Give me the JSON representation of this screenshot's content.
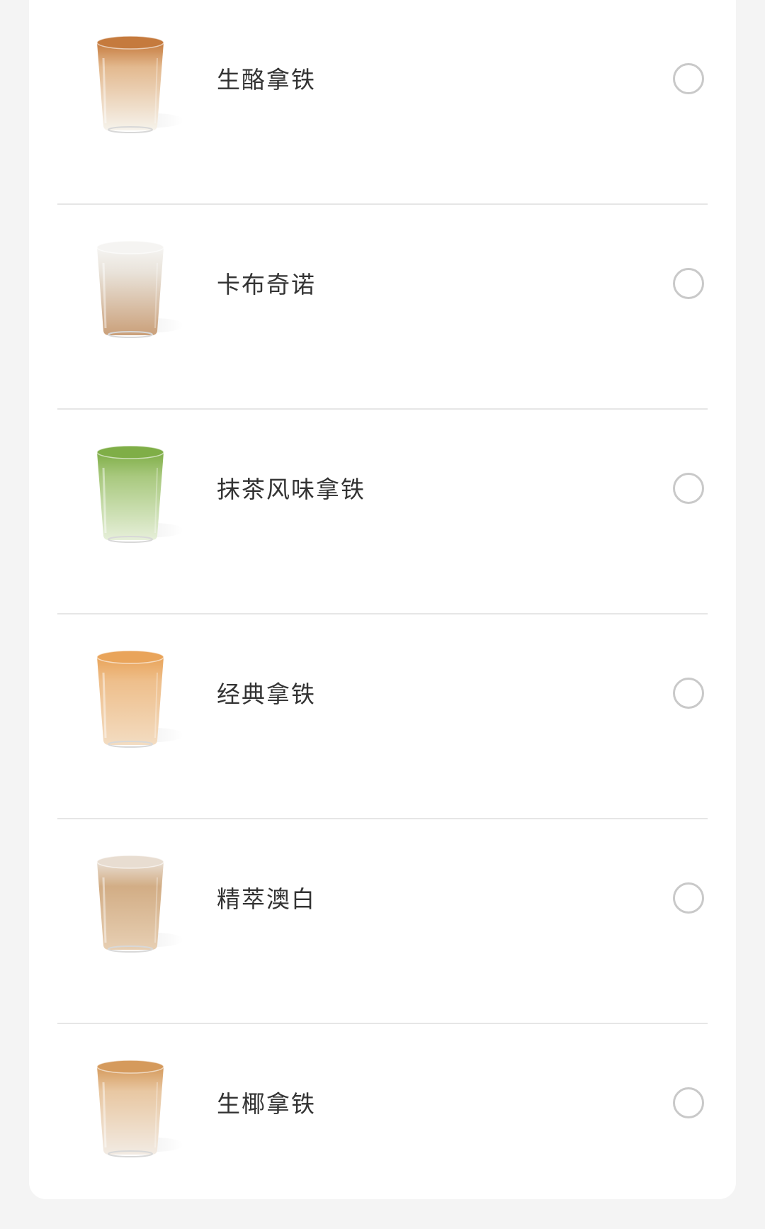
{
  "drinks": [
    {
      "name": "生酪拿铁",
      "icon": "cheese-latte-cup-icon",
      "selected": false,
      "colors": {
        "top": "#c57a3d",
        "mid": "#e3b98f",
        "body": "#f6f3ec"
      }
    },
    {
      "name": "卡布奇诺",
      "icon": "cappuccino-cup-icon",
      "selected": false,
      "colors": {
        "top": "#f5f4f2",
        "mid": "#e9e3da",
        "body": "#caa07a"
      }
    },
    {
      "name": "抹茶风味拿铁",
      "icon": "matcha-latte-cup-icon",
      "selected": false,
      "colors": {
        "top": "#7fae47",
        "mid": "#a9c97f",
        "body": "#e6efd9"
      }
    },
    {
      "name": "经典拿铁",
      "icon": "classic-latte-cup-icon",
      "selected": false,
      "colors": {
        "top": "#e9a45a",
        "mid": "#eebf8c",
        "body": "#f3dcc1"
      }
    },
    {
      "name": "精萃澳白",
      "icon": "flat-white-cup-icon",
      "selected": false,
      "colors": {
        "top": "#e8ddd1",
        "mid": "#d2ad85",
        "body": "#e7cfb3"
      }
    },
    {
      "name": "生椰拿铁",
      "icon": "coconut-latte-cup-icon",
      "selected": false,
      "colors": {
        "top": "#d59a5c",
        "mid": "#e8c7a2",
        "body": "#f2ebe3"
      }
    }
  ]
}
